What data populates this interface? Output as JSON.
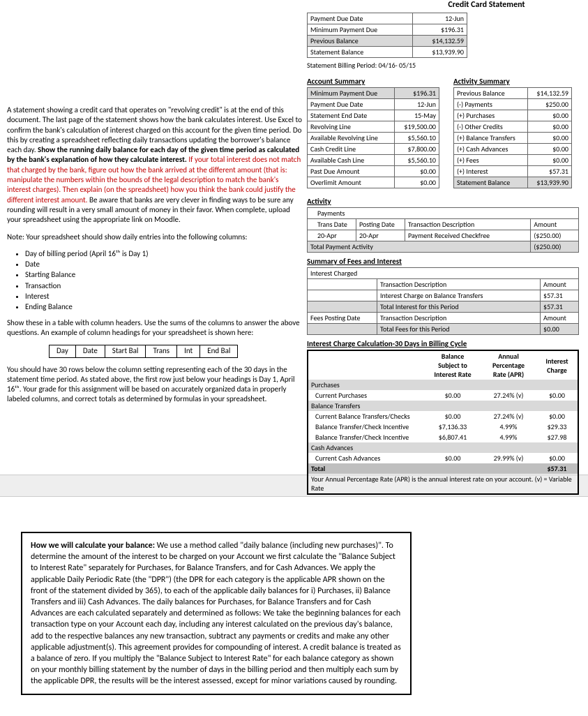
{
  "title": "Credit Card Statement",
  "top_box": {
    "rows": [
      {
        "label": "Payment Due Date",
        "val": "12-Jun",
        "gray": false
      },
      {
        "label": "Minimum Payment Due",
        "val": "$196.31",
        "gray": false
      },
      {
        "label": "Previous Balance",
        "val": "$14,132.59",
        "gray": true
      },
      {
        "label": "Statement Balance",
        "val": "$13,939.90",
        "gray": false
      }
    ]
  },
  "billing_period": "Statement Billing Period: 04/16- 05/15",
  "account_summary": {
    "title": "Account Summary",
    "rows": [
      {
        "label": "Minimum Payment Due",
        "val": "$196.31",
        "gray": true
      },
      {
        "label": "Payment Due Date",
        "val": "12-Jun",
        "gray": false
      },
      {
        "label": "Statement End Date",
        "val": "15-May",
        "gray": false
      },
      {
        "label": "Revolving Line",
        "val": "$19,500.00",
        "gray": false
      },
      {
        "label": "Available Revolving Line",
        "val": "$5,560.10",
        "gray": false
      },
      {
        "label": "Cash Credit Line",
        "val": "$7,800.00",
        "gray": false
      },
      {
        "label": "Available Cash Line",
        "val": "$5,560.10",
        "gray": false
      },
      {
        "label": "Past Due Amount",
        "val": "$0.00",
        "gray": false
      },
      {
        "label": "Overlimit Amount",
        "val": "$0.00",
        "gray": false
      }
    ]
  },
  "activity_summary": {
    "title": "Activity Summary",
    "rows": [
      {
        "label": "Previous Balance",
        "val": "$14,132.59",
        "gray": false
      },
      {
        "label": "(-) Payments",
        "val": "$250.00",
        "gray": false
      },
      {
        "label": "(+) Purchases",
        "val": "$0.00",
        "gray": false
      },
      {
        "label": "(-) Other Credits",
        "val": "$0.00",
        "gray": false
      },
      {
        "label": "(+) Balance Transfers",
        "val": "$0.00",
        "gray": false
      },
      {
        "label": "(+) Cash Advances",
        "val": "$0.00",
        "gray": false
      },
      {
        "label": "(+) Fees",
        "val": "$0.00",
        "gray": false
      },
      {
        "label": "(+) Interest",
        "val": "$57.31",
        "gray": false
      },
      {
        "label": "Statement Balance",
        "val": "$13,939.90",
        "gray": true
      }
    ]
  },
  "activity": {
    "title": "Activity",
    "sub": "Payments",
    "cols": [
      "Trans Date",
      "Posting Date",
      "Transaction Description",
      "Amount"
    ],
    "row": [
      "20-Apr",
      "20-Apr",
      "Payment Received Checkfree",
      "($250.00)"
    ],
    "total_label": "Total Payment Activity",
    "total_val": "($250.00)"
  },
  "fees": {
    "title": "Summary of Fees and Interest",
    "sub": "Interest Charged",
    "rows1": [
      {
        "a": "",
        "b": "Transaction Description",
        "c": "Amount"
      },
      {
        "a": "",
        "b": "Interest Charge on Balance Transfers",
        "c": "$57.31"
      },
      {
        "a": "",
        "b": "Total Interest for this Period",
        "c": "$57.31",
        "gray": true
      }
    ],
    "rows2": [
      {
        "a": "Fees Posting Date",
        "b": "Transaction Description",
        "c": "Amount"
      },
      {
        "a": "",
        "b": "Total Fees for this Period",
        "c": "$0.00",
        "gray": true
      }
    ]
  },
  "interest_calc": {
    "title": "Interest Charge Calculation-30 Days in Billing Cycle",
    "headers": [
      "Balance Subject to Interest Rate",
      "Annual Percentage Rate (APR)",
      "Interest Charge"
    ],
    "sections": [
      {
        "name": "Purchases",
        "rows": [
          {
            "label": "Current Purchases",
            "a": "$0.00",
            "b": "27.24% (v)",
            "c": "$0.00"
          }
        ]
      },
      {
        "name": "Balance Transfers",
        "rows": [
          {
            "label": "Current Balance Transfers/Checks",
            "a": "$0.00",
            "b": "27.24% (v)",
            "c": "$0.00"
          },
          {
            "label": "Balance Transfer/Check Incentive",
            "a": "$7,136.33",
            "b": "4.99%",
            "c": "$29.33"
          },
          {
            "label": "Balance Transfer/Check Incentive",
            "a": "$6,807.41",
            "b": "4.99%",
            "c": "$27.98"
          }
        ]
      },
      {
        "name": "Cash Advances",
        "rows": [
          {
            "label": "Current Cash Advances",
            "a": "$0.00",
            "b": "29.99% (v)",
            "c": "$0.00"
          }
        ]
      }
    ],
    "total_label": "Total",
    "total_val": "$57.31",
    "footnote": "Your Annual Percentage Rate (APR) is the annual interest rate on your account.  (v) = Variable Rate"
  },
  "instr": {
    "p1a": "A statement showing a credit card that operates on \"revolving credit\" is at the end of this document.  The last page of the statement shows how the bank calculates interest.  Use Excel to confirm the bank's calculation of interest charged on this account for the given time period.  Do this by creating a spreadsheet reflecting daily transactions updating the borrower's balance each day.  ",
    "p1b": "Show the running daily balance for each day of the given time period as calculated by the bank's explanation of how they calculate interest.",
    "p1c": "  If your total interest does not match that charged by the bank, figure out how the bank arrived at the different amount (that is: manipulate the numbers within the bounds of the legal description to match the bank's interest charges).  Then explain (on the spreadsheet) how you think the bank could justify the different interest amount.",
    "p1d": "  Be aware that banks are very clever in finding ways to be sure any rounding will result in a very small amount of money in their favor.  When complete, upload your spreadsheet using the appropriate link on Moodle.",
    "p2": "Note: Your spreadsheet should show daily entries into the following columns:",
    "bullets": [
      "Day of billing period (April 16ᵗʰ is Day 1)",
      "Date",
      "Starting Balance",
      "Transaction",
      "Interest",
      "Ending Balance"
    ],
    "p3": "Show these in a table with column headers.  Use the sums of the columns to answer the above questions. An example of column headings for your spreadsheet is shown here:",
    "ex_cols": [
      "Day",
      "Date",
      "Start Bal",
      "Trans",
      "Int",
      "End Bal"
    ],
    "p4": "You should have 30 rows below the column setting representing each of the 30 days in the statement time period.  As stated above, the first row just below your headings is Day 1, April 16ᵗʰ.  Your grade for this assignment will be based on accurately organized data in properly labeled columns, and correct totals as determined by formulas in your spreadsheet."
  },
  "calc_box": "How we will calculate your balance:  We use a method called \"daily balance (including new purchases)\".  To determine the amount of the interest to be charged on your Account we first calculate the \"Balance Subject to Interest Rate\" separately for Purchases, for Balance Transfers, and for Cash Advances.  We apply the applicable Daily Periodic Rate (the \"DPR\")  (the DPR for each category is the applicable APR shown on the front of the statement divided by 365), to each of the applicable daily balances for i) Purchases, ii) Balance Transfers and iii) Cash Advances.  The daily balances for Purchases, for Balance Transfers and for Cash Advances are each calculated separately and determined as follows:  We take the beginning balances for each transaction type on your Account each day, including any interest calculated on the previous day's balance, add to the respective balances any new transaction, subtract any payments or credits and make any other applicable adjustment(s).  This agreement provides for compounding of interest.  A credit balance is treated as a balance of zero.  If you multiply the \"Balance Subject to Interest Rate\" for each balance category as shown on your monthly billing statement by the number of days in the billing period and then multiply each sum by the applicable DPR, the results will be the interest assessed, except for minor variations caused by rounding."
}
